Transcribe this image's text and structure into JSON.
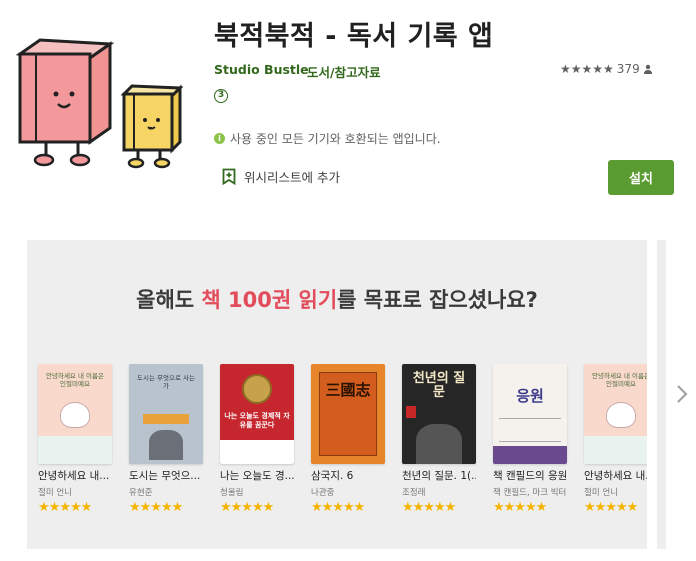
{
  "app": {
    "title": "북적북적 - 독서 기록 앱",
    "developer": "Studio Bustle",
    "category": "도서/참고자료",
    "rating_count": "379",
    "rating_stars": 5,
    "content_rating": "3",
    "compat_text": "사용 중인 모든 기기와 호환되는 앱입니다.",
    "wishlist_label": "위시리스트에 추가",
    "install_label": "설치"
  },
  "screenshot": {
    "headline_before": "올해도 ",
    "headline_highlight": "책 100권 읽기",
    "headline_after": "를 목표로 잡으셨나요?",
    "books": [
      {
        "title": "안녕하세요 내...",
        "author": "절미 언니",
        "stars": "★★★★★",
        "cover_text": "안녕하세요 내 이름은 인절미예요"
      },
      {
        "title": "도시는 무엇으...",
        "author": "유현준",
        "stars": "★★★★★",
        "cover_text": "도시는 무엇으로 사는가"
      },
      {
        "title": "나는 오늘도 경...",
        "author": "청울림",
        "stars": "★★★★★",
        "cover_text": "나는 오늘도 경제적 자유를 꿈꾼다"
      },
      {
        "title": "삼국지. 6",
        "author": "나관중",
        "stars": "★★★★★",
        "cover_text": "三國志"
      },
      {
        "title": "천년의 질문. 1(...",
        "author": "조정래",
        "stars": "★★★★★",
        "cover_text": "천년의 질문"
      },
      {
        "title": "책 캔필드의 응원",
        "author": "잭 캔필드, 마크 빅터...",
        "stars": "★★★★★",
        "cover_text": "응원"
      },
      {
        "title": "안녕하세요 내...",
        "author": "절미 언니",
        "stars": "★★★★★",
        "cover_text": "안녕하세요 내 이름은 인절미예요"
      }
    ]
  },
  "colors": {
    "accent": "#33691e",
    "install": "#5a9b32",
    "highlight": "#e24c5b",
    "star": "#f5b400"
  },
  "icons": {
    "rating": "star-icon",
    "info": "info-icon",
    "wishlist": "bookmark-add-icon",
    "next": "chevron-right-icon"
  }
}
